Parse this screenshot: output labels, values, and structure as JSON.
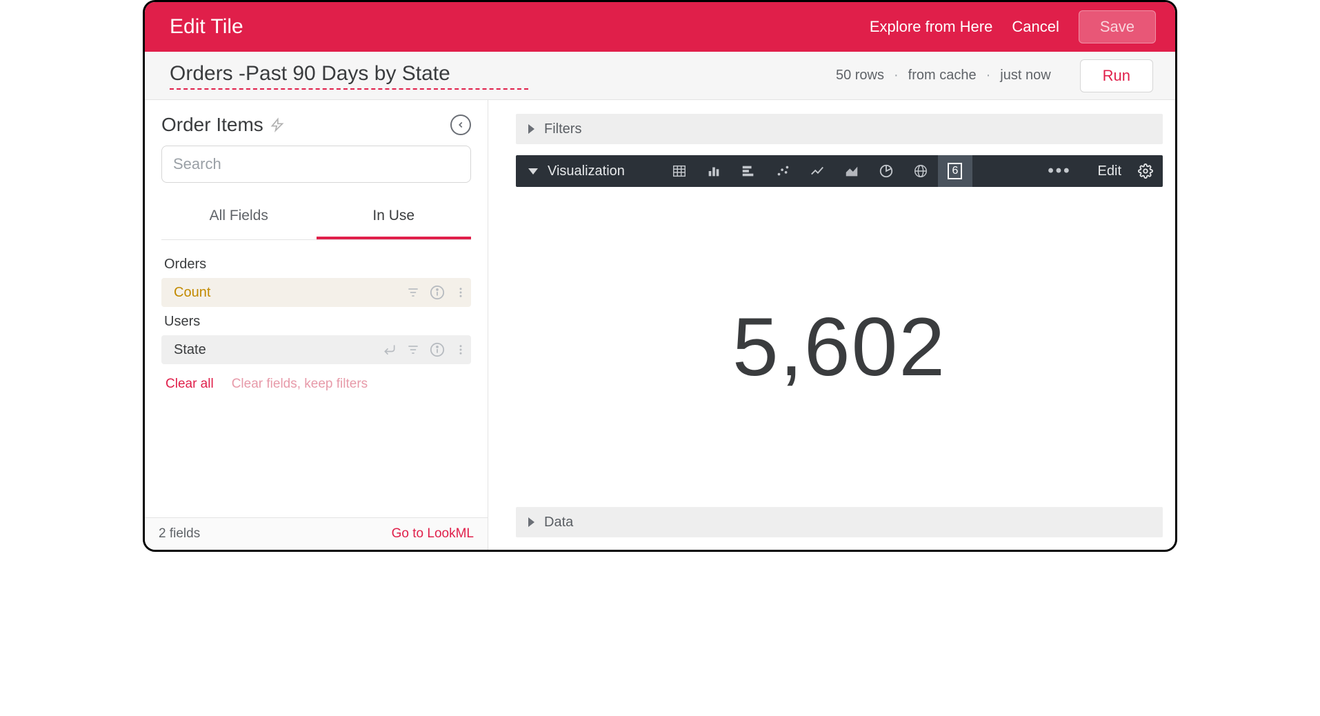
{
  "topbar": {
    "title": "Edit Tile",
    "explore_from_here": "Explore from Here",
    "cancel": "Cancel",
    "save": "Save"
  },
  "subheader": {
    "tile_title": "Orders -Past 90 Days by State",
    "rows_label": "50 rows",
    "cache_label": "from cache",
    "time_label": "just now",
    "run": "Run"
  },
  "sidebar": {
    "explore_name": "Order Items",
    "search_placeholder": "Search",
    "tabs": {
      "all_fields": "All Fields",
      "in_use": "In Use"
    },
    "groups": {
      "orders": {
        "label": "Orders",
        "field": "Count"
      },
      "users": {
        "label": "Users",
        "field": "State"
      }
    },
    "clear_all": "Clear all",
    "clear_keep": "Clear fields, keep filters",
    "footer_count": "2 fields",
    "go_lookml": "Go to LookML"
  },
  "main": {
    "filters_label": "Filters",
    "visualization_label": "Visualization",
    "viz_number_glyph": "6",
    "viz_edit": "Edit",
    "single_value": "5,602",
    "data_label": "Data"
  }
}
